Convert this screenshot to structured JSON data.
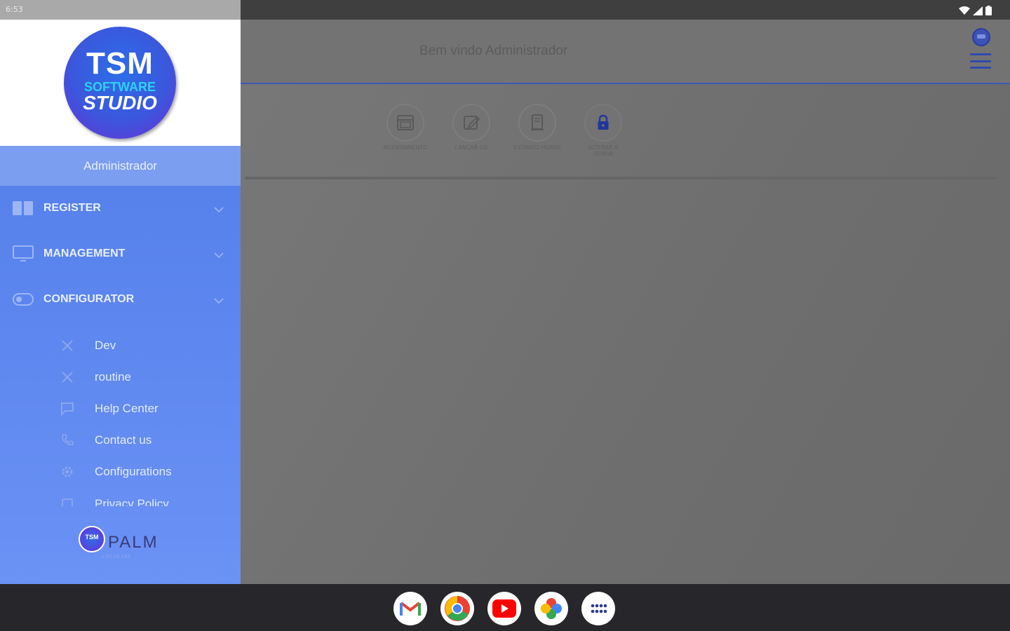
{
  "status_bar": {
    "time": "6:53",
    "icons": [
      "wifi-icon",
      "signal-icon",
      "battery-icon"
    ]
  },
  "header": {
    "welcome": "Bem vindo Administrador",
    "avatar_icon": "tsm-avatar-icon",
    "menu_icon": "hamburger-menu-icon"
  },
  "shortcuts": [
    {
      "label": "AGENDAMENTO",
      "icon": "calendar-icon"
    },
    {
      "label": "LANÇAR OS",
      "icon": "edit-icon"
    },
    {
      "label": "EXTRATO HORAS",
      "icon": "document-icon"
    },
    {
      "label": "ALTERAR A SENHA",
      "icon": "lock-icon"
    }
  ],
  "drawer": {
    "logo": {
      "line1": "TSM",
      "line2": "SOFTWARE",
      "line3": "STUDIO"
    },
    "user_name": "Administrador",
    "menu": [
      {
        "label": "REGISTER",
        "icon": "book-icon"
      },
      {
        "label": "MANAGEMENT",
        "icon": "monitor-icon"
      },
      {
        "label": "CONFIGURATOR",
        "icon": "toggle-icon"
      }
    ],
    "submenu": [
      {
        "label": "Dev",
        "icon": "tools-icon"
      },
      {
        "label": "routine",
        "icon": "tools-icon"
      },
      {
        "label": "Help Center",
        "icon": "chat-icon"
      },
      {
        "label": "Contact us",
        "icon": "phone-icon"
      },
      {
        "label": "Configurations",
        "icon": "gear-icon"
      },
      {
        "label": "Privacy Policy",
        "icon": "shield-icon"
      }
    ],
    "footer": {
      "badge": "TSM",
      "brand": "PALM",
      "version": "v 25.04.185"
    }
  },
  "taskbar": {
    "apps": [
      "gmail-icon",
      "chrome-icon",
      "youtube-icon",
      "photos-icon",
      "app-drawer-icon"
    ]
  },
  "colors": {
    "drawer_top": "#4f7ae6",
    "drawer_bottom": "#6b92f5",
    "accent": "#2f49b0",
    "overlay": "#6f6f6f"
  }
}
